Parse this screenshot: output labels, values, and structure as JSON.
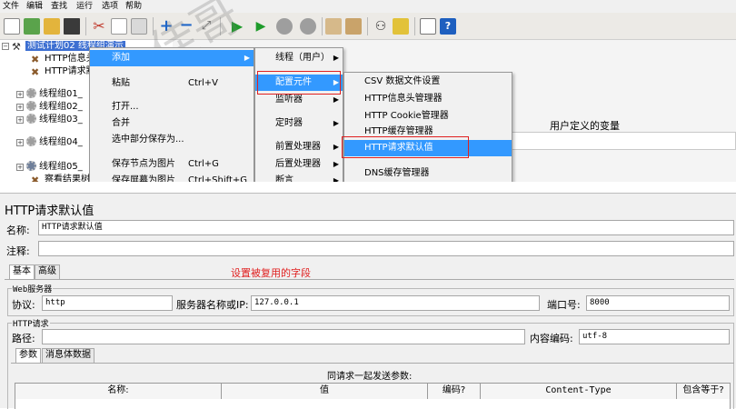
{
  "menubar": [
    "文件",
    "编辑",
    "查找",
    "运行",
    "选项",
    "帮助"
  ],
  "tree": {
    "root_label": "测试计划02 线程组演示",
    "items": [
      {
        "label": "HTTP信息头",
        "icon": "wrench-icon"
      },
      {
        "label": "HTTP请求默",
        "icon": "wrench-icon"
      },
      {
        "label": "线程组01_",
        "icon": "gear-icon"
      },
      {
        "label": "线程组02_",
        "icon": "gear-icon"
      },
      {
        "label": "线程组03_",
        "icon": "gear-icon"
      },
      {
        "label": "线程组04_",
        "icon": "gear-icon"
      },
      {
        "label": "线程组05_",
        "icon": "gear-icon"
      },
      {
        "label": "察看结果树",
        "icon": "listener-icon"
      }
    ]
  },
  "context_menu": {
    "items": [
      {
        "label": "添加",
        "shortcut": "",
        "has_submenu": true
      },
      {
        "label": "粘贴",
        "shortcut": "Ctrl+V",
        "has_submenu": false
      },
      {
        "label": "打开...",
        "shortcut": "",
        "has_submenu": false
      },
      {
        "label": "合并",
        "shortcut": "",
        "has_submenu": false
      },
      {
        "label": "选中部分保存为...",
        "shortcut": "",
        "has_submenu": false
      },
      {
        "label": "保存节点为图片",
        "shortcut": "Ctrl+G",
        "has_submenu": false
      },
      {
        "label": "保存屏幕为图片",
        "shortcut": "Ctrl+Shift+G",
        "has_submenu": false
      }
    ]
  },
  "submenu_add": {
    "items": [
      {
        "label": "线程（用户）"
      },
      {
        "label": "配置元件"
      },
      {
        "label": "监听器"
      },
      {
        "label": "定时器"
      },
      {
        "label": "前置处理器"
      },
      {
        "label": "后置处理器"
      },
      {
        "label": "断言"
      }
    ]
  },
  "submenu_config": {
    "items": [
      {
        "label": "CSV 数据文件设置"
      },
      {
        "label": "HTTP信息头管理器"
      },
      {
        "label": "HTTP Cookie管理器"
      },
      {
        "label": "HTTP缓存管理器"
      },
      {
        "label": "HTTP请求默认值"
      },
      {
        "label": "DNS缓存管理器"
      }
    ]
  },
  "right_panel": {
    "user_vars_title": "用户定义的变量"
  },
  "watermark": "佳哥",
  "form": {
    "title": "HTTP请求默认值",
    "name_label": "名称:",
    "name_value": "HTTP请求默认值",
    "comment_label": "注释:",
    "comment_value": "",
    "tabs": [
      "基本",
      "高级"
    ],
    "annotation": "设置被复用的字段",
    "web_server": {
      "group_label": "Web服务器",
      "protocol_label": "协议:",
      "protocol_value": "http",
      "server_label": "服务器名称或IP:",
      "server_value": "127.0.0.1",
      "port_label": "端口号:",
      "port_value": "8000"
    },
    "http_request": {
      "group_label": "HTTP请求",
      "path_label": "路径:",
      "path_value": "",
      "encoding_label": "内容编码:",
      "encoding_value": "utf-8"
    },
    "param_tabs": [
      "参数",
      "消息体数据"
    ],
    "params_title": "同请求一起发送参数:",
    "columns": [
      "名称:",
      "值",
      "编码?",
      "Content-Type",
      "包含等于?"
    ]
  },
  "colors": {
    "selection": "#3399ff",
    "highlight_box": "#e02020",
    "annotation": "#e02020",
    "tree_selection": "#3d6fd1"
  }
}
